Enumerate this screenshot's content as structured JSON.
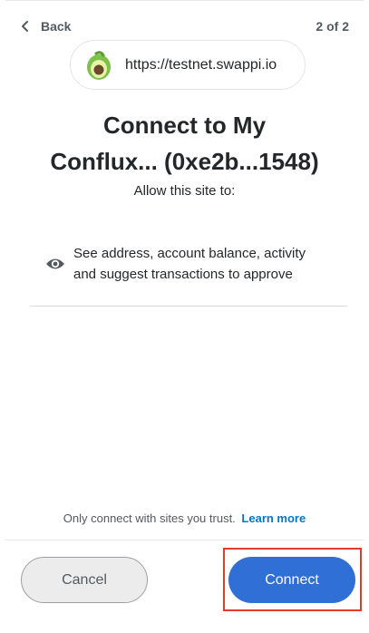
{
  "header": {
    "back_label": "Back",
    "step": "2 of 2"
  },
  "site": {
    "url": "https://testnet.swappi.io",
    "favicon_icon": "avocado-icon"
  },
  "title_line1": "Connect to My",
  "title_line2": "Conflux... (0xe2b...1548)",
  "subtitle": "Allow this site to:",
  "permission": {
    "icon": "eye-icon",
    "line1": "See address, account balance, activity",
    "line2": "and suggest transactions to approve"
  },
  "footer": {
    "trust_text": "Only connect with sites you trust.",
    "learn_more": "Learn more",
    "cancel_label": "Cancel",
    "connect_label": "Connect"
  },
  "colors": {
    "primary": "#2f6fd6",
    "link": "#0376c9",
    "highlight": "#e23b2a"
  }
}
